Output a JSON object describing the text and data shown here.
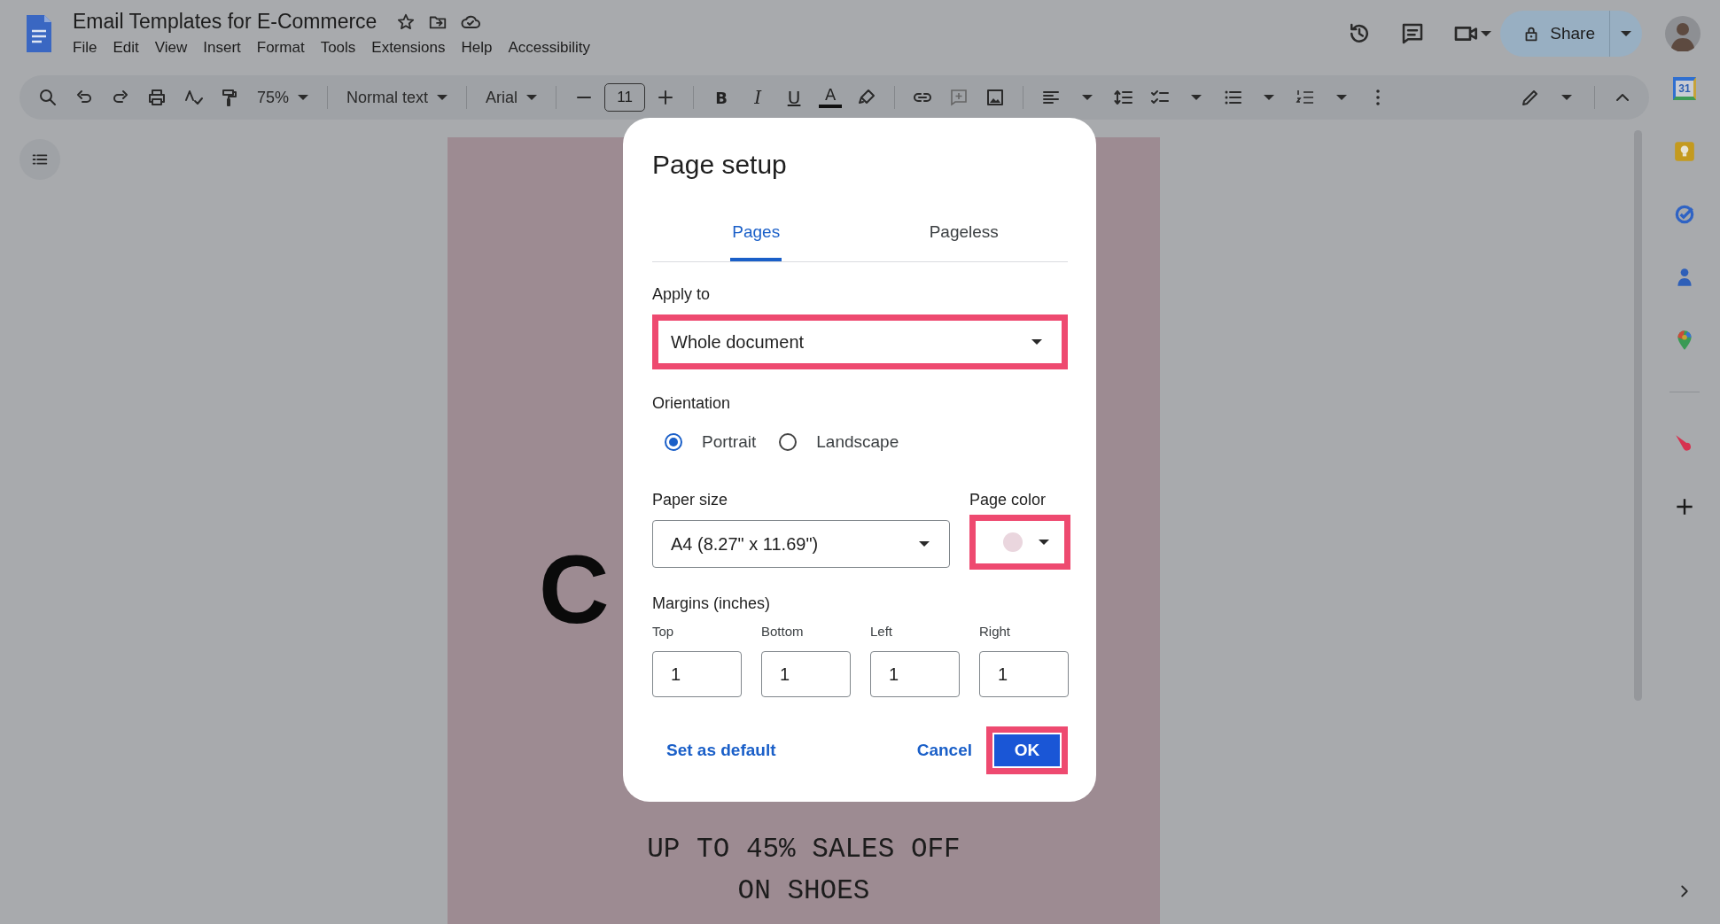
{
  "document_title": "Email Templates for E-Commerce",
  "menu": [
    "File",
    "Edit",
    "View",
    "Insert",
    "Format",
    "Tools",
    "Extensions",
    "Help",
    "Accessibility"
  ],
  "share_button": {
    "label": "Share"
  },
  "toolbar": {
    "zoom": "75%",
    "style": "Normal text",
    "font": "Arial",
    "font_size": "11",
    "format_buttons": [
      {
        "kind": "bold",
        "label": "B"
      },
      {
        "kind": "italic",
        "label": "I"
      },
      {
        "kind": "underline",
        "label": "U"
      },
      {
        "kind": "text-color",
        "label": "A"
      }
    ]
  },
  "side_panel": {
    "calendar_label": "31"
  },
  "document": {
    "lines": [
      {
        "kind": "headline-start",
        "text": "C"
      },
      {
        "kind": "body",
        "text": "UP TO 45% SALES OFF"
      },
      {
        "kind": "body",
        "text": "ON SHOES"
      }
    ]
  },
  "dialog": {
    "title": "Page setup",
    "tabs": [
      {
        "label": "Pages",
        "selected": true
      },
      {
        "label": "Pageless",
        "selected": false
      }
    ],
    "apply_to": {
      "label": "Apply to",
      "value": "Whole document",
      "highlighted": true
    },
    "orientation": {
      "label": "Orientation",
      "options": [
        {
          "label": "Portrait",
          "selected": true
        },
        {
          "label": "Landscape",
          "selected": false
        }
      ]
    },
    "paper_size": {
      "label": "Paper size",
      "value": "A4 (8.27\" x 11.69\")",
      "highlighted": false
    },
    "page_color": {
      "label": "Page color",
      "color": "#ead6de",
      "highlighted": true
    },
    "margins": {
      "label": "Margins (inches)",
      "fields": [
        {
          "label": "Top",
          "value": "1"
        },
        {
          "label": "Bottom",
          "value": "1"
        },
        {
          "label": "Left",
          "value": "1"
        },
        {
          "label": "Right",
          "value": "1"
        }
      ]
    },
    "buttons": [
      {
        "kind": "link",
        "label": "Set as default",
        "highlighted": false
      },
      {
        "kind": "text",
        "label": "Cancel",
        "highlighted": false
      },
      {
        "kind": "primary",
        "label": "OK",
        "highlighted": true
      }
    ]
  }
}
